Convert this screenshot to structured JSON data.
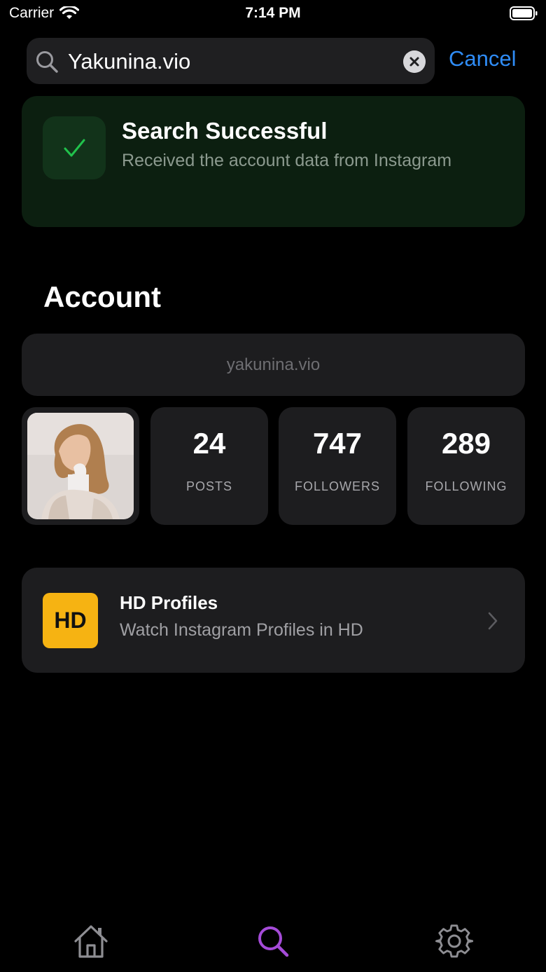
{
  "status_bar": {
    "carrier": "Carrier",
    "time": "7:14 PM"
  },
  "search": {
    "value": "Yakunina.vio",
    "cancel_label": "Cancel"
  },
  "success": {
    "title": "Search Successful",
    "subtitle": "Received the account data from Instagram"
  },
  "account": {
    "section_title": "Account",
    "username": "yakunina.vio",
    "stats": [
      {
        "value": "24",
        "label": "POSTS"
      },
      {
        "value": "747",
        "label": "FOLLOWERS"
      },
      {
        "value": "289",
        "label": "FOLLOWING"
      }
    ]
  },
  "hd_profiles": {
    "badge": "HD",
    "title": "HD Profiles",
    "subtitle": "Watch Instagram Profiles in HD"
  },
  "tab_bar": {
    "items": [
      "home-icon",
      "search-icon",
      "gear-icon"
    ],
    "active": "search-icon",
    "active_color": "#a54bd8",
    "inactive_color": "#8e8e93"
  },
  "colors": {
    "accent": "#2f8cf6",
    "success": "#21c24c",
    "hd_badge": "#f6b312"
  }
}
